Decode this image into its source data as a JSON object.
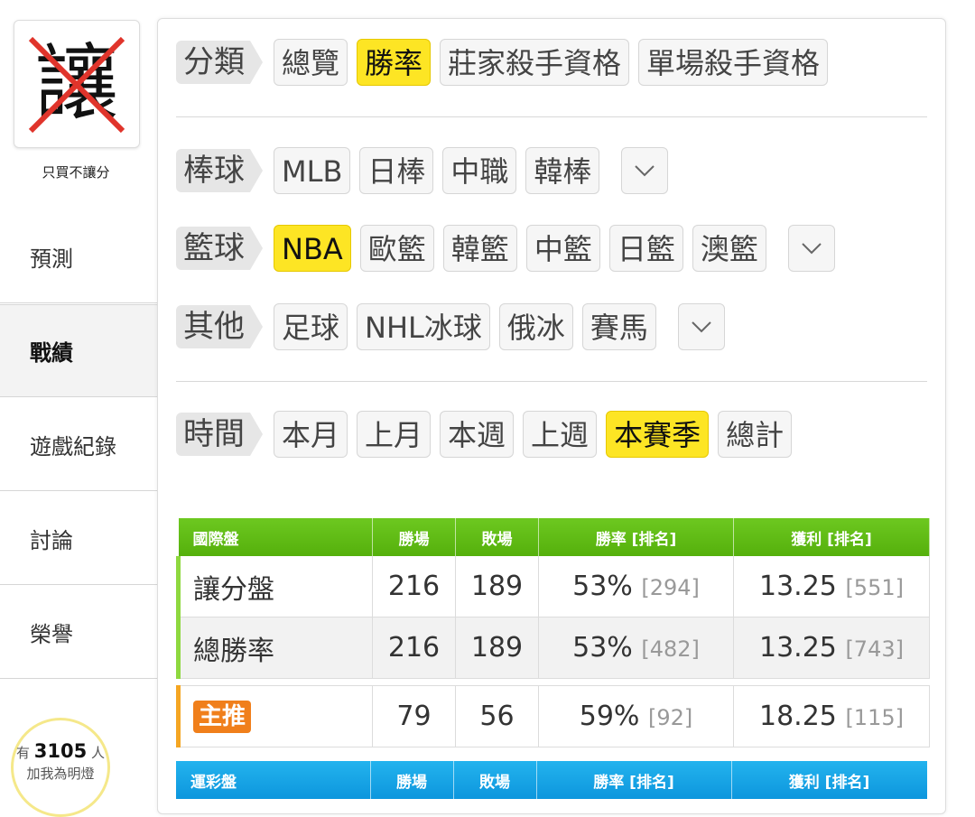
{
  "profile": {
    "avatar_char": "讓",
    "name": "只買不讓分"
  },
  "nav": {
    "predict": "預測",
    "record": "戰績",
    "games": "遊戲紀錄",
    "discuss": "討論",
    "honor": "榮譽"
  },
  "fans": {
    "prefix": "有",
    "count": "3105",
    "suffix": "人",
    "caption": "加我為明燈"
  },
  "filters": {
    "category": {
      "label": "分類",
      "chips": [
        "總覽",
        "勝率",
        "莊家殺手資格",
        "單場殺手資格"
      ],
      "selected": "勝率"
    },
    "baseball": {
      "label": "棒球",
      "chips": [
        "MLB",
        "日棒",
        "中職",
        "韓棒"
      ]
    },
    "basketball": {
      "label": "籃球",
      "chips": [
        "NBA",
        "歐籃",
        "韓籃",
        "中籃",
        "日籃",
        "澳籃"
      ],
      "selected": "NBA"
    },
    "other": {
      "label": "其他",
      "chips": [
        "足球",
        "NHL冰球",
        "俄冰",
        "賽馬"
      ]
    },
    "time": {
      "label": "時間",
      "chips": [
        "本月",
        "上月",
        "本週",
        "上週",
        "本賽季",
        "總計"
      ],
      "selected": "本賽季"
    }
  },
  "intl_table": {
    "headers": [
      "國際盤",
      "勝場",
      "敗場",
      "勝率 [排名]",
      "獲利 [排名]"
    ],
    "rows": [
      {
        "name": "讓分盤",
        "win": "216",
        "lose": "189",
        "rate": "53%",
        "rate_rank": "[294]",
        "profit": "13.25",
        "profit_rank": "[551]"
      },
      {
        "name": "總勝率",
        "win": "216",
        "lose": "189",
        "rate": "53%",
        "rate_rank": "[482]",
        "profit": "13.25",
        "profit_rank": "[743]"
      }
    ],
    "main_pick": {
      "tag": "主推",
      "win": "79",
      "lose": "56",
      "rate": "59%",
      "rate_rank": "[92]",
      "profit": "18.25",
      "profit_rank": "[115]"
    }
  },
  "lottery_table": {
    "headers": [
      "運彩盤",
      "勝場",
      "敗場",
      "勝率 [排名]",
      "獲利 [排名]"
    ]
  },
  "colors": {
    "selected": "#fde524",
    "green_header": "#5cb812",
    "blue_header": "#17a5e6",
    "main_pick_tag": "#f07f1b"
  }
}
